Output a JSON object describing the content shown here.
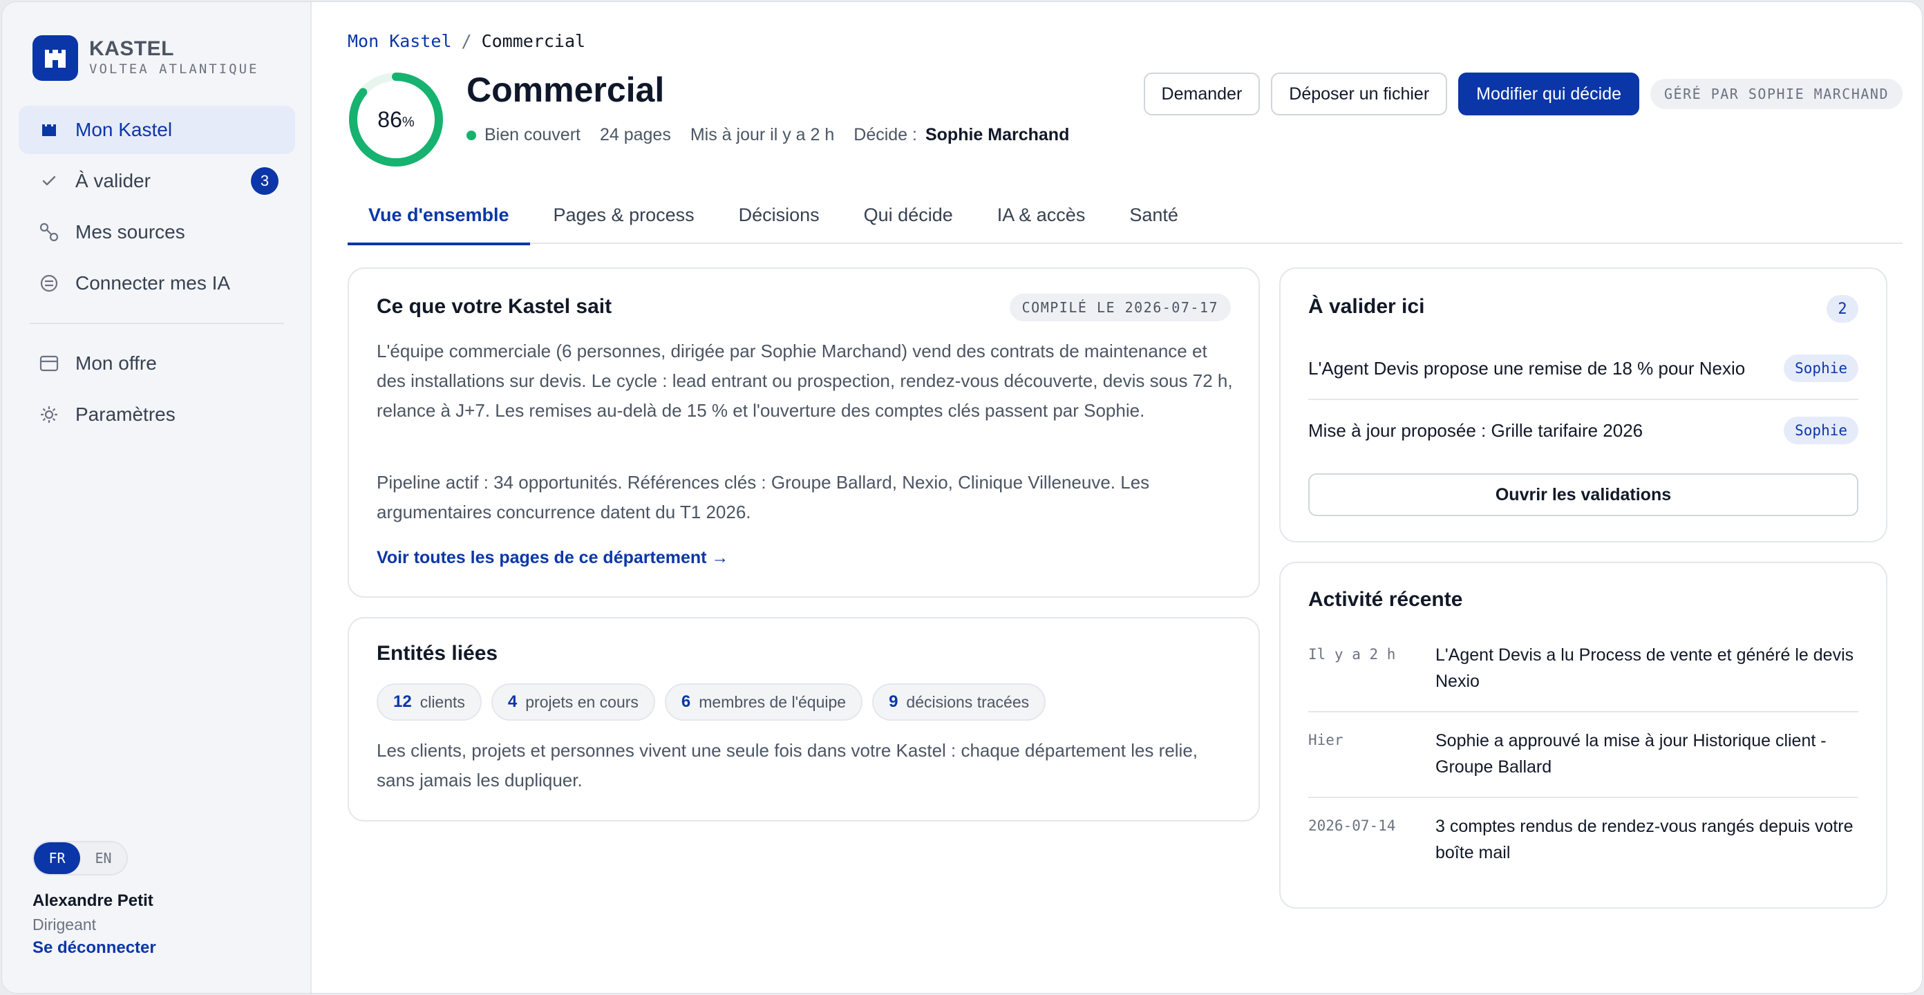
{
  "brand": {
    "name": "KASTEL",
    "subtitle": "VOLTEA ATLANTIQUE"
  },
  "sidebar": {
    "items": [
      {
        "label": "Mon Kastel",
        "icon": "castle-icon",
        "active": true
      },
      {
        "label": "À valider",
        "icon": "check-icon",
        "badge": "3"
      },
      {
        "label": "Mes sources",
        "icon": "sources-icon"
      },
      {
        "label": "Connecter mes IA",
        "icon": "ai-connect-icon"
      }
    ],
    "items_secondary": [
      {
        "label": "Mon offre",
        "icon": "card-icon"
      },
      {
        "label": "Paramètres",
        "icon": "gear-icon"
      }
    ],
    "lang": {
      "fr": "FR",
      "en": "EN",
      "selected": "FR"
    },
    "user": {
      "name": "Alexandre Petit",
      "role": "Dirigeant",
      "logout": "Se déconnecter"
    }
  },
  "breadcrumb": {
    "root": "Mon Kastel",
    "separator": "/",
    "current": "Commercial"
  },
  "header": {
    "coverage_value": "86",
    "coverage_unit": "%",
    "coverage_fraction": 0.86,
    "title": "Commercial",
    "status": "Bien couvert",
    "status_color": "#16b26f",
    "pages": "24 pages",
    "updated": "Mis à jour il y a 2 h",
    "decider_label": "Décide :",
    "decider_name": "Sophie Marchand"
  },
  "actions": {
    "ask": "Demander",
    "upload": "Déposer un fichier",
    "edit_decider": "Modifier qui décide",
    "managed_by": "GÉRÉ PAR SOPHIE MARCHAND"
  },
  "tabs": [
    {
      "label": "Vue d'ensemble",
      "active": true
    },
    {
      "label": "Pages & process"
    },
    {
      "label": "Décisions"
    },
    {
      "label": "Qui décide"
    },
    {
      "label": "IA & accès"
    },
    {
      "label": "Santé"
    }
  ],
  "knowledge": {
    "title": "Ce que votre Kastel sait",
    "compiled": "COMPILÉ LE 2026-07-17",
    "para1": "L'équipe commerciale (6 personnes, dirigée par Sophie Marchand) vend des contrats de maintenance et des installations sur devis. Le cycle : lead entrant ou prospection, rendez-vous découverte, devis sous 72 h, relance à J+7. Les remises au-delà de 15 % et l'ouverture des comptes clés passent par Sophie.",
    "para2": "Pipeline actif : 34 opportunités. Références clés : Groupe Ballard, Nexio, Clinique Villeneuve. Les argumentaires concurrence datent du T1 2026.",
    "link": "Voir toutes les pages de ce département →"
  },
  "entities": {
    "title": "Entités liées",
    "chips": [
      {
        "count": "12",
        "label": "clients"
      },
      {
        "count": "4",
        "label": "projets en cours"
      },
      {
        "count": "6",
        "label": "membres de l'équipe"
      },
      {
        "count": "9",
        "label": "décisions tracées"
      }
    ],
    "text": "Les clients, projets et personnes vivent une seule fois dans votre Kastel : chaque département les relie, sans jamais les dupliquer."
  },
  "validate": {
    "title": "À valider ici",
    "count": "2",
    "items": [
      {
        "text": "L'Agent Devis propose une remise de 18 % pour Nexio",
        "who": "Sophie"
      },
      {
        "text": "Mise à jour proposée : Grille tarifaire 2026",
        "who": "Sophie"
      }
    ],
    "button": "Ouvrir les validations"
  },
  "activity": {
    "title": "Activité récente",
    "items": [
      {
        "time": "Il y a 2 h",
        "text": "L'Agent Devis a lu Process de vente et généré le devis Nexio"
      },
      {
        "time": "Hier",
        "text": "Sophie a approuvé la mise à jour Historique client - Groupe Ballard"
      },
      {
        "time": "2026-07-14",
        "text": "3 comptes rendus de rendez-vous rangés depuis votre boîte mail"
      }
    ]
  },
  "colors": {
    "accent": "#0a36a8",
    "success": "#16b26f"
  }
}
